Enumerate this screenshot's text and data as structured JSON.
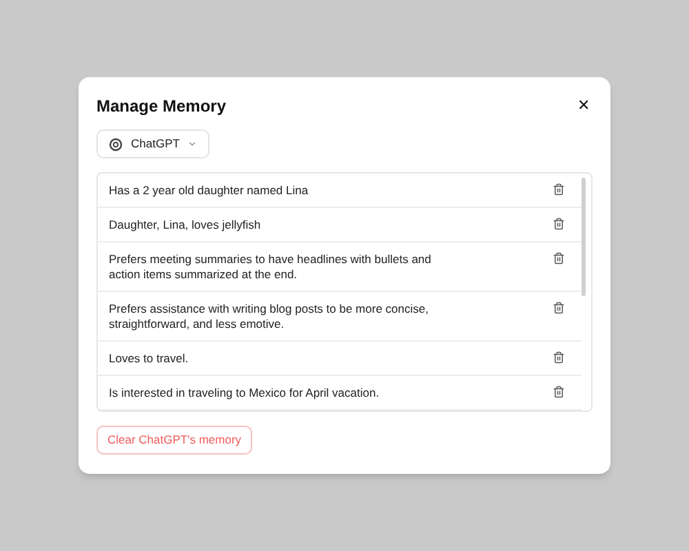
{
  "dialog": {
    "title": "Manage Memory",
    "close": "✕"
  },
  "source": {
    "label": "ChatGPT"
  },
  "memories": [
    {
      "text": "Has a 2 year old daughter named Lina"
    },
    {
      "text": "Daughter, Lina, loves jellyfish"
    },
    {
      "text": "Prefers meeting summaries to have headlines with bullets and action items summarized at the end."
    },
    {
      "text": "Prefers assistance with writing blog posts to be more concise, straightforward, and less emotive."
    },
    {
      "text": "Loves to travel."
    },
    {
      "text": "Is interested in traveling to Mexico for April vacation."
    }
  ],
  "clear_button": "Clear ChatGPT's memory"
}
